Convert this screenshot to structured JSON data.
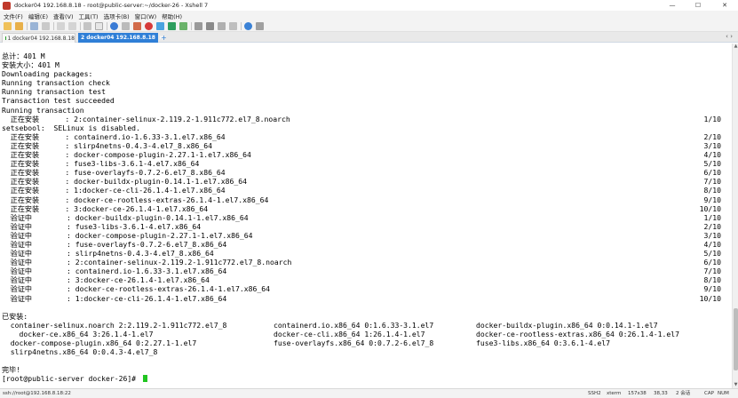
{
  "window": {
    "title": "docker04 192.168.8.18 - root@public-server:~/docker-26 - Xshell 7",
    "minimize": "—",
    "maximize": "☐",
    "close": "✕"
  },
  "menu": [
    "文件(F)",
    "编辑(E)",
    "查看(V)",
    "工具(T)",
    "选项卡(B)",
    "窗口(W)",
    "帮助(H)"
  ],
  "tabs": [
    {
      "label": "1 docker04 192.168.8.18",
      "close": "×"
    },
    {
      "label": "2 docker04 192.168.8.18",
      "close": "×"
    }
  ],
  "tab_add": "+",
  "tab_more": "‹ ›",
  "terminal": {
    "lines": [
      {
        "text": "总计：401 M",
        "right": ""
      },
      {
        "text": "安装大小：401 M",
        "right": ""
      },
      {
        "text": "Downloading packages:",
        "right": ""
      },
      {
        "text": "Running transaction check",
        "right": ""
      },
      {
        "text": "Running transaction test",
        "right": ""
      },
      {
        "text": "Transaction test succeeded",
        "right": ""
      },
      {
        "text": "Running transaction",
        "right": ""
      },
      {
        "text": "  正在安装      : 2:container-selinux-2.119.2-1.911c772.el7_8.noarch",
        "right": "1/10"
      },
      {
        "text": "setsebool:  SELinux is disabled.",
        "right": ""
      },
      {
        "text": "  正在安装      : containerd.io-1.6.33-3.1.el7.x86_64",
        "right": "2/10"
      },
      {
        "text": "  正在安装      : slirp4netns-0.4.3-4.el7_8.x86_64",
        "right": "3/10"
      },
      {
        "text": "  正在安装      : docker-compose-plugin-2.27.1-1.el7.x86_64",
        "right": "4/10"
      },
      {
        "text": "  正在安装      : fuse3-libs-3.6.1-4.el7.x86_64",
        "right": "5/10"
      },
      {
        "text": "  正在安装      : fuse-overlayfs-0.7.2-6.el7_8.x86_64",
        "right": "6/10"
      },
      {
        "text": "  正在安装      : docker-buildx-plugin-0.14.1-1.el7.x86_64",
        "right": "7/10"
      },
      {
        "text": "  正在安装      : 1:docker-ce-cli-26.1.4-1.el7.x86_64",
        "right": "8/10"
      },
      {
        "text": "  正在安装      : docker-ce-rootless-extras-26.1.4-1.el7.x86_64",
        "right": "9/10"
      },
      {
        "text": "  正在安装      : 3:docker-ce-26.1.4-1.el7.x86_64",
        "right": "10/10"
      },
      {
        "text": "  验证中        : docker-buildx-plugin-0.14.1-1.el7.x86_64",
        "right": "1/10"
      },
      {
        "text": "  验证中        : fuse3-libs-3.6.1-4.el7.x86_64",
        "right": "2/10"
      },
      {
        "text": "  验证中        : docker-compose-plugin-2.27.1-1.el7.x86_64",
        "right": "3/10"
      },
      {
        "text": "  验证中        : fuse-overlayfs-0.7.2-6.el7_8.x86_64",
        "right": "4/10"
      },
      {
        "text": "  验证中        : slirp4netns-0.4.3-4.el7_8.x86_64",
        "right": "5/10"
      },
      {
        "text": "  验证中        : 2:container-selinux-2.119.2-1.911c772.el7_8.noarch",
        "right": "6/10"
      },
      {
        "text": "  验证中        : containerd.io-1.6.33-3.1.el7.x86_64",
        "right": "7/10"
      },
      {
        "text": "  验证中        : 3:docker-ce-26.1.4-1.el7.x86_64",
        "right": "8/10"
      },
      {
        "text": "  验证中        : docker-ce-rootless-extras-26.1.4-1.el7.x86_64",
        "right": "9/10"
      },
      {
        "text": "  验证中        : 1:docker-ce-cli-26.1.4-1.el7.x86_64",
        "right": "10/10"
      },
      {
        "text": "",
        "right": ""
      },
      {
        "text": "已安装:",
        "right": ""
      }
    ],
    "installed_rows": [
      [
        "  container-selinux.noarch 2:2.119.2-1.911c772.el7_8",
        "containerd.io.x86_64 0:1.6.33-3.1.el7",
        "docker-buildx-plugin.x86_64 0:0.14.1-1.el7"
      ],
      [
        "    docker-ce.x86_64 3:26.1.4-1.el7",
        "docker-ce-cli.x86_64 1:26.1.4-1.el7",
        "docker-ce-rootless-extras.x86_64 0:26.1.4-1.el7"
      ],
      [
        "  docker-compose-plugin.x86_64 0:2.27.1-1.el7",
        "fuse-overlayfs.x86_64 0:0.7.2-6.el7_8",
        "fuse3-libs.x86_64 0:3.6.1-4.el7"
      ],
      [
        "  slirp4netns.x86_64 0:0.4.3-4.el7_8",
        "",
        ""
      ]
    ],
    "done": "完毕!",
    "prompt": "[root@public-server docker-26]# "
  },
  "status": {
    "connection": "ssh://root@192.168.8.18:22",
    "protocol": "SSH2",
    "term": "xterm",
    "size": "157x38",
    "position": "38,33",
    "sessions": "2 会话",
    "caps": "CAP",
    "num": "NUM"
  },
  "colors": {
    "active_tab": "#2f7fd7",
    "cursor": "#21c521",
    "close_icon": "#c0392b"
  }
}
